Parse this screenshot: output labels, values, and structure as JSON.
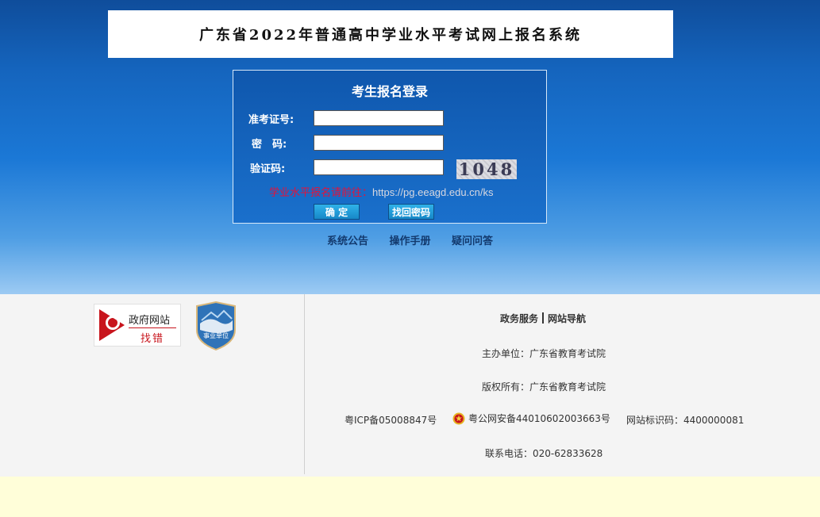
{
  "header": {
    "title": "广东省2022年普通高中学业水平考试网上报名系统"
  },
  "login": {
    "title": "考生报名登录",
    "exam_id_label": "准考证号:",
    "password_label": "密　码:",
    "captcha_label": "验证码:",
    "exam_id_value": "",
    "password_value": "",
    "captcha_value": "",
    "captcha_image_text": "1048",
    "notice_text": "学业水平报名请前往：",
    "notice_url": "https://pg.eeagd.edu.cn/ks",
    "confirm_button": "确 定",
    "recover_button": "找回密码"
  },
  "nav_links": [
    "系统公告",
    "操作手册",
    "疑问问答"
  ],
  "footer": {
    "gov_badge_line1": "政府网站",
    "gov_badge_line2": "找错",
    "unit_badge_text": "事业单位",
    "gov_services": "政务服务",
    "site_nav": "网站导航",
    "sponsor": "主办单位：广东省教育考试院",
    "copyright": "版权所有：广东省教育考试院",
    "icp": "粤ICP备05008847号",
    "police_record": "粤公网安备44010602003663号",
    "site_id": "网站标识码：4400000081",
    "phone": "联系电话：020-62833628"
  },
  "colors": {
    "accent_blue": "#1565be",
    "notice_red": "#e4123a",
    "footer_bg": "#f4f4f4",
    "page_bottom_bg": "#fffed9"
  },
  "icons": [
    "magnifier-icon",
    "public-institution-badge-icon",
    "police-emblem-icon"
  ]
}
